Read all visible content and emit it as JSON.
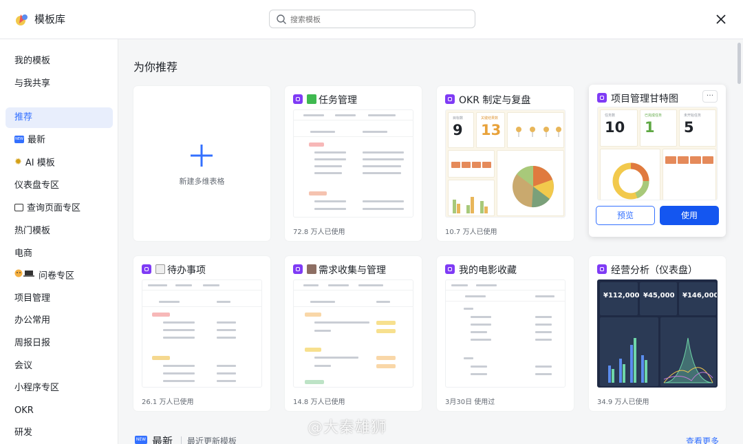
{
  "header": {
    "app_title": "模板库",
    "search_placeholder": "搜索模板",
    "logo_icon": "template-logo-icon",
    "close_icon": "close-icon"
  },
  "sidebar": {
    "items": [
      {
        "label": "我的模板"
      },
      {
        "label": "与我共享"
      },
      {
        "label": "推荐",
        "active": true
      },
      {
        "label": "最新",
        "icon": "new-badge-icon"
      },
      {
        "label": "AI 模板",
        "icon": "sparkle-icon"
      },
      {
        "label": "仪表盘专区"
      },
      {
        "label": "查询页面专区",
        "icon": "window-icon"
      },
      {
        "label": "热门模板"
      },
      {
        "label": "电商"
      },
      {
        "label": "问卷专区",
        "icon": "person-laptop-icon"
      },
      {
        "label": "项目管理"
      },
      {
        "label": "办公常用"
      },
      {
        "label": "周报日报"
      },
      {
        "label": "会议"
      },
      {
        "label": "小程序专区"
      },
      {
        "label": "OKR"
      },
      {
        "label": "研发"
      }
    ]
  },
  "main": {
    "section_title": "为你推荐",
    "new_card": {
      "label": "新建多维表格"
    },
    "cards": [
      {
        "title": "任务管理",
        "usage": "72.8 万人已使用",
        "emoji": "check-emoji-icon"
      },
      {
        "title": "OKR 制定与复盘",
        "usage": "10.7 万人已使用",
        "stats": [
          {
            "label": "目标数",
            "value": "9"
          },
          {
            "label": "关键结果数",
            "value": "13"
          }
        ]
      },
      {
        "title": "项目管理甘特图",
        "stats": [
          {
            "label": "任务数",
            "value": "10"
          },
          {
            "label": "已完成任务",
            "value": "1"
          },
          {
            "label": "未开始任务",
            "value": "5"
          }
        ],
        "actions": {
          "preview": "预览",
          "use": "使用",
          "more": "···"
        }
      },
      {
        "title": "待办事项",
        "usage": "26.1 万人已使用",
        "emoji": "memo-emoji-icon"
      },
      {
        "title": "需求收集与管理",
        "usage": "14.8 万人已使用",
        "emoji": "tools-emoji-icon"
      },
      {
        "title": "我的电影收藏",
        "usage": "3月30日 使用过"
      },
      {
        "title": "经营分析（仪表盘）",
        "usage": "34.9 万人已使用",
        "stats": [
          {
            "value": "¥112,000"
          },
          {
            "value": "¥45,000"
          },
          {
            "value": "¥146,000"
          }
        ]
      }
    ],
    "latest_section": {
      "badge": "NEW",
      "title": "最新",
      "subtitle": "最近更新模板",
      "see_more": "查看更多"
    }
  },
  "watermark": "@大秦雄狮",
  "colors": {
    "accent": "#3370ff",
    "primary_button": "#1456f0",
    "template_badge": "#7f3bf5",
    "active_bg": "#e8eefc"
  }
}
